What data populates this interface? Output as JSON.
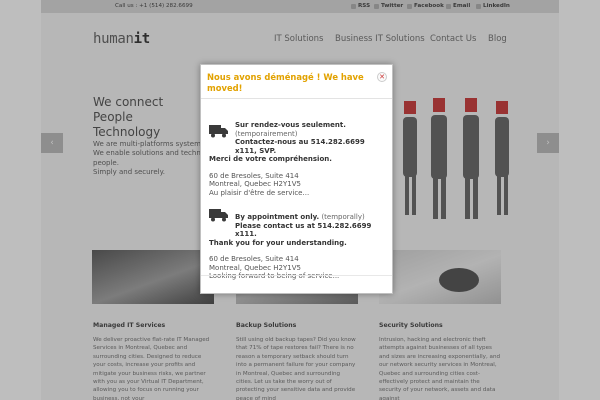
{
  "topbar": {
    "call": "Call us : +1 (514) 282.6699",
    "social": [
      "RSS",
      "Twitter",
      "Facebook",
      "Email",
      "LinkedIn"
    ]
  },
  "logo": {
    "main": "human",
    "suffix": "it"
  },
  "nav": [
    "IT Solutions",
    "Business IT Solutions",
    "Contact Us",
    "Blog"
  ],
  "hero": {
    "title": "We connect People Technology",
    "lines": [
      "We are multi-platforms system",
      "We enable solutions and techn",
      "people.",
      "Simply and securely."
    ]
  },
  "carousel": {
    "prev": "‹",
    "next": "›"
  },
  "columns": [
    {
      "heading": "Managed IT Services",
      "text": "We deliver proactive flat-rate IT Managed Services in Montreal, Quebec and surrounding cities. Designed to reduce your costs, increase your profits and mitigate your business risks, we partner with you as your Virtual IT Department, allowing you to focus on running your business, not your"
    },
    {
      "heading": "Backup Solutions",
      "text": "Still using old backup tapes? Did you know that 71% of tape restores fail? There is no reason a temporary setback should turn into a permanent failure for your company in Montreal, Quebec and surrounding cities. Let us take the worry out of protecting your sensitive data and provide peace of mind"
    },
    {
      "heading": "Security Solutions",
      "text": "Intrusion, hacking and electronic theft attempts against businesses of all types and sizes are increasing exponentially, and our network security services in Montreal, Quebec and surrounding cities cost-effectively protect and maintain the security of your network, assets and data against"
    }
  ],
  "modal": {
    "title": "Nous avons déménagé ! We have moved!",
    "close": "✕",
    "fr": {
      "headline": "Sur rendez-vous seulement.",
      "note": "(temporairement)",
      "contact": "Contactez-nous au 514.282.6699 x111, SVP.",
      "thanks": "Merci de votre compréhension.",
      "address": [
        "60 de Bresoles, Suite 414",
        "Montreal, Quebec  H2Y1V5",
        "Au plaisir d'être de service..."
      ]
    },
    "en": {
      "headline": "By appointment only.",
      "note": "(temporally)",
      "contact": "Please contact us at 514.282.6699 x111.",
      "thanks": "Thank you for your understanding.",
      "address": [
        "60 de Bresoles, Suite 414",
        "Montreal, Quebec  H2Y1V5",
        "Looking forward to being of service..."
      ]
    }
  },
  "colors": {
    "accent": "#e2a200",
    "overlay": "#464646",
    "close": "#cc3333",
    "header_red": "#c62828"
  }
}
